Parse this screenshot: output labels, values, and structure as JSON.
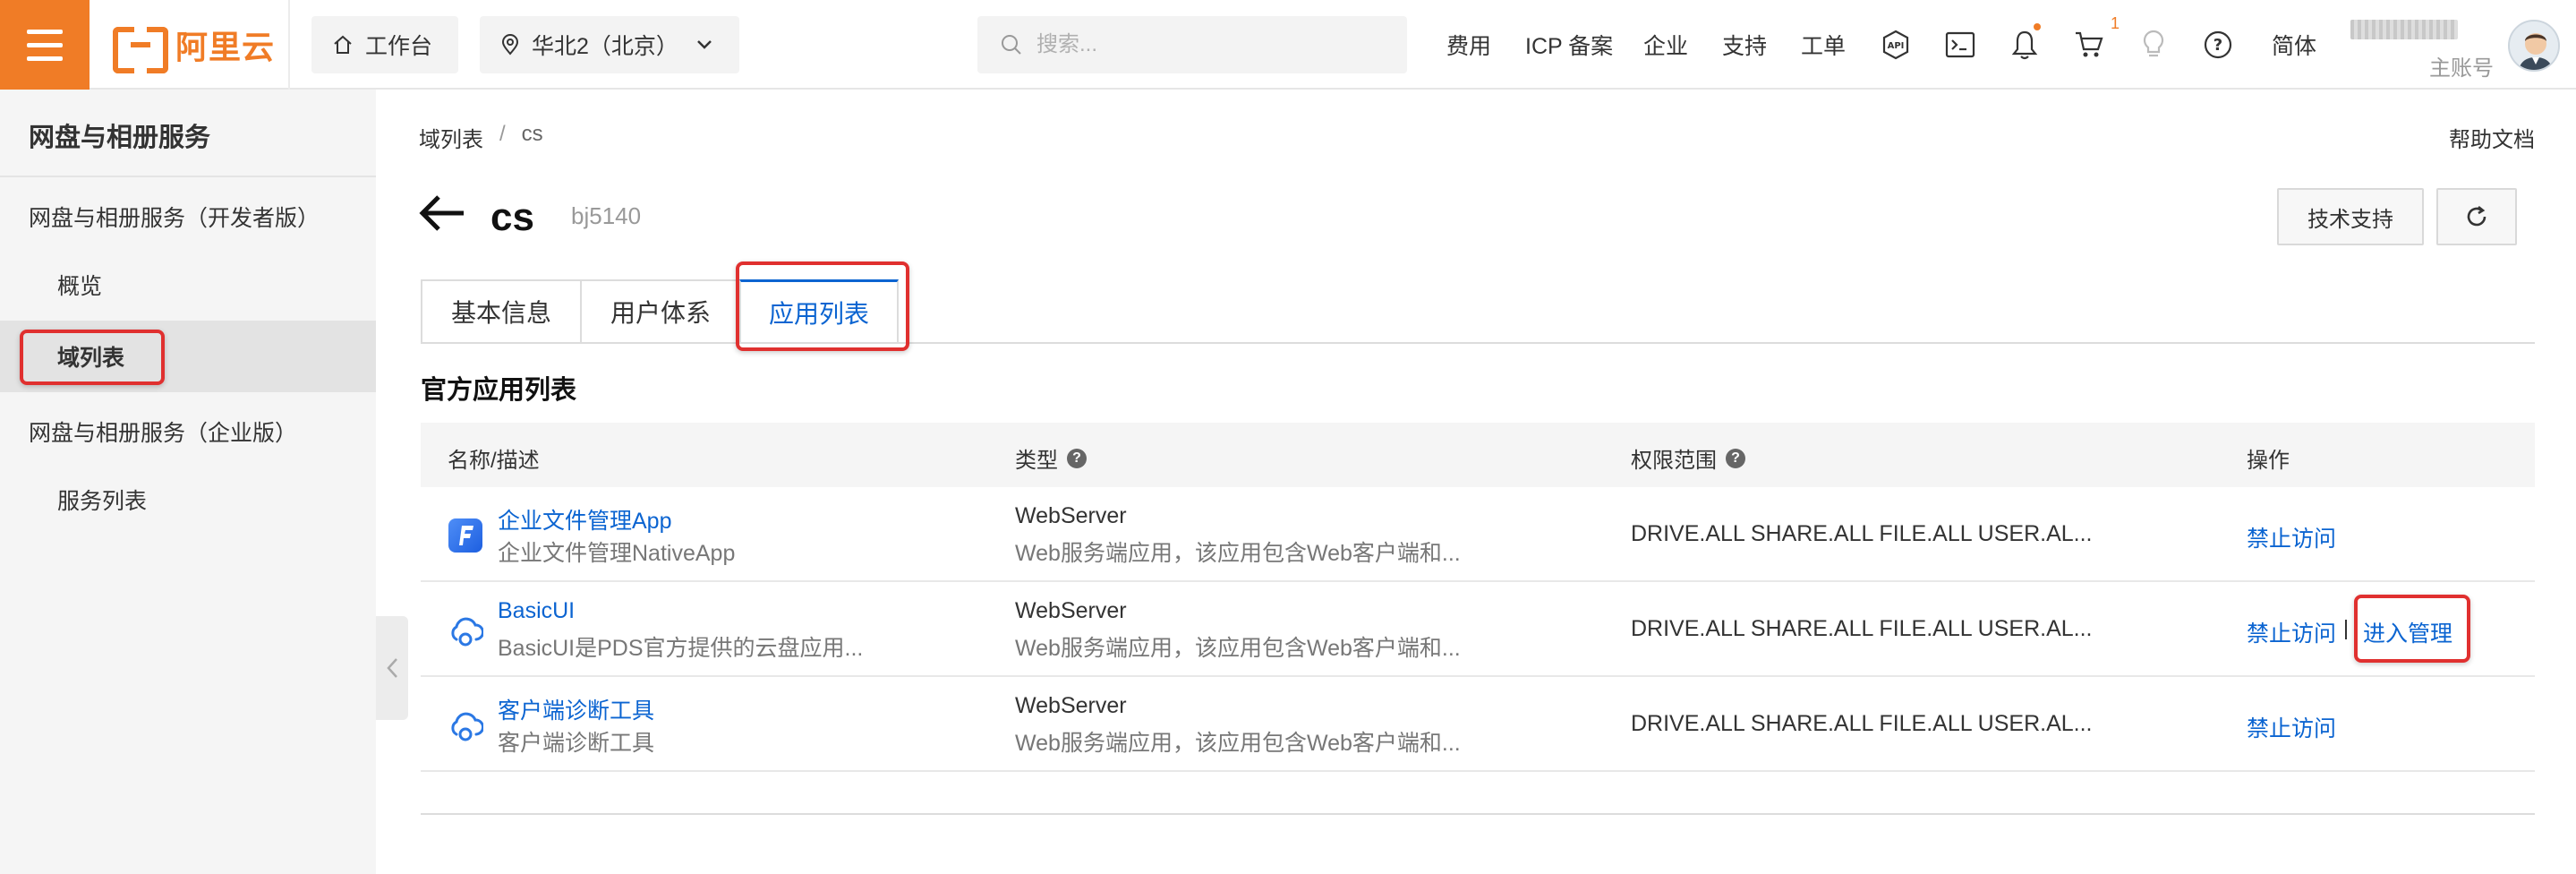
{
  "topbar": {
    "logo_text": "阿里云",
    "workbench": "工作台",
    "region": "华北2（北京）",
    "search_placeholder": "搜索...",
    "links": [
      "费用",
      "ICP 备案",
      "企业",
      "支持",
      "工单"
    ],
    "cart_count": "1",
    "language": "简体",
    "account_role": "主账号",
    "icons": [
      "menu-icon",
      "home-icon",
      "location-icon",
      "chevron-down-icon",
      "search-icon",
      "api-icon",
      "terminal-icon",
      "bell-icon",
      "cart-icon",
      "lightbulb-icon",
      "help-icon"
    ],
    "accent_color": "#f07c26"
  },
  "sidebar": {
    "title": "网盘与相册服务",
    "groups": [
      {
        "label": "网盘与相册服务（开发者版）",
        "items": [
          "概览",
          "域列表"
        ]
      },
      {
        "label": "网盘与相册服务（企业版）",
        "items": [
          "服务列表"
        ]
      }
    ],
    "active_item": "域列表"
  },
  "breadcrumb": {
    "items": [
      "域列表",
      "cs"
    ],
    "separator": "/"
  },
  "help_doc": "帮助文档",
  "page": {
    "title": "cs",
    "id": "bj5140",
    "tech_support": "技术支持"
  },
  "tabs": [
    "基本信息",
    "用户体系",
    "应用列表"
  ],
  "active_tab": "应用列表",
  "section_title": "官方应用列表",
  "table": {
    "headers": [
      "名称/描述",
      "类型",
      "权限范围",
      "操作"
    ],
    "rows": [
      {
        "name": "企业文件管理App",
        "desc": "企业文件管理NativeApp",
        "type": "WebServer",
        "type_desc": "Web服务端应用，该应用包含Web客户端和...",
        "scope": "DRIVE.ALL SHARE.ALL FILE.ALL USER.AL...",
        "actions": [
          "禁止访问"
        ],
        "icon": "app-f-icon"
      },
      {
        "name": "BasicUI",
        "desc": "BasicUI是PDS官方提供的云盘应用...",
        "type": "WebServer",
        "type_desc": "Web服务端应用，该应用包含Web客户端和...",
        "scope": "DRIVE.ALL SHARE.ALL FILE.ALL USER.AL...",
        "actions": [
          "禁止访问",
          "进入管理"
        ],
        "icon": "cloud-icon"
      },
      {
        "name": "客户端诊断工具",
        "desc": "客户端诊断工具",
        "type": "WebServer",
        "type_desc": "Web服务端应用，该应用包含Web客户端和...",
        "scope": "DRIVE.ALL SHARE.ALL FILE.ALL USER.AL...",
        "actions": [
          "禁止访问"
        ],
        "icon": "cloud-icon"
      }
    ]
  },
  "link_color": "#0b64d1",
  "highlight_color": "#e0302f"
}
